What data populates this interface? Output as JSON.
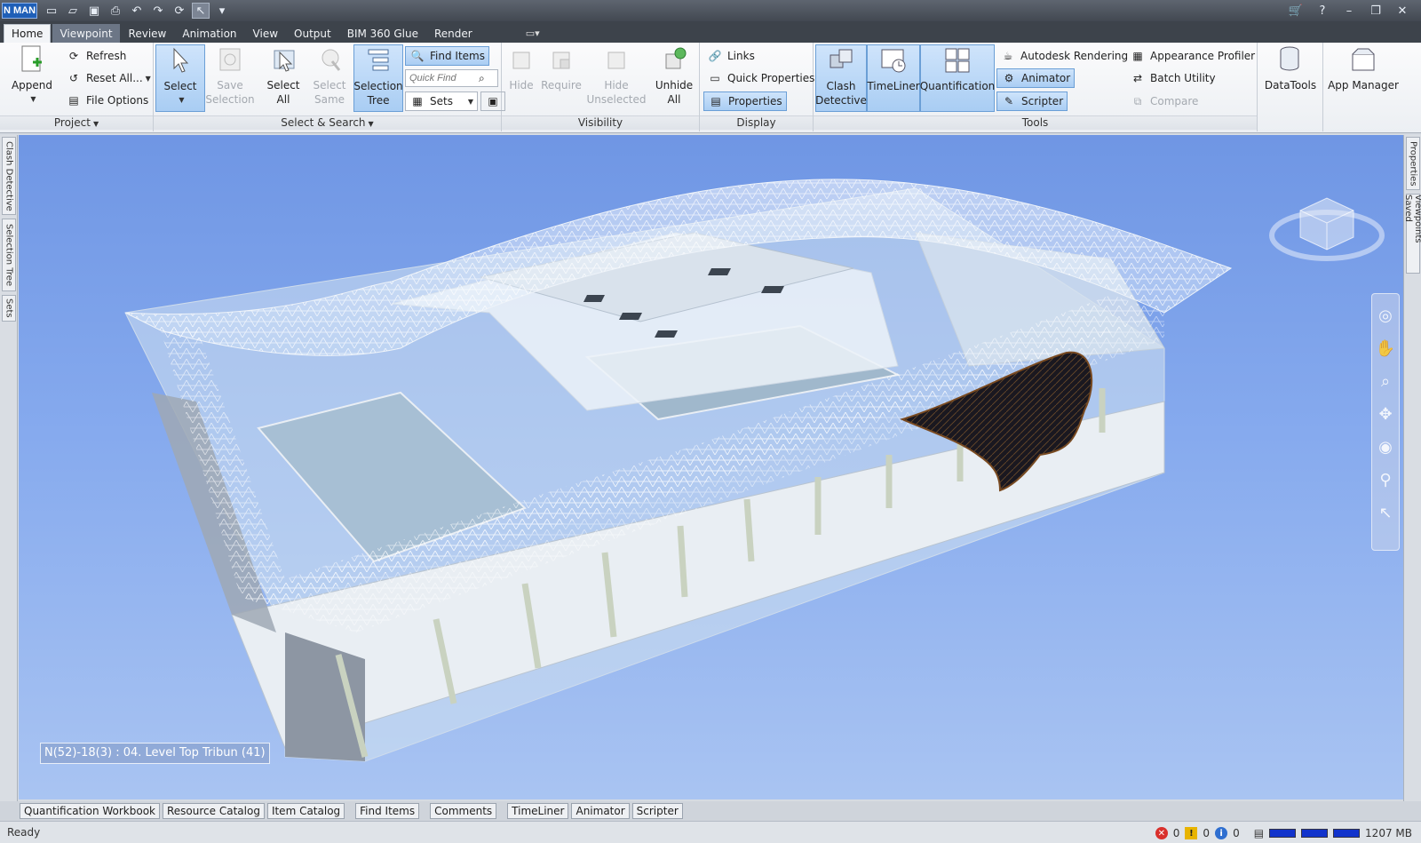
{
  "app": {
    "logo": "N MAN"
  },
  "titlebar": {
    "quick_access_icons": [
      "new-file-icon",
      "open-folder-icon",
      "save-icon",
      "print-icon",
      "undo-icon",
      "redo-icon",
      "refresh-icon",
      "select-pointer-icon",
      "customize-icon"
    ]
  },
  "tabs": [
    "Home",
    "Viewpoint",
    "Review",
    "Animation",
    "View",
    "Output",
    "BIM 360 Glue",
    "Render"
  ],
  "ribbon": {
    "project": {
      "label": "Project",
      "append": "Append",
      "refresh": "Refresh",
      "reset_all": "Reset All...",
      "file_options": "File Options"
    },
    "select_search": {
      "label": "Select & Search",
      "select": "Select",
      "save_selection_1": "Save",
      "save_selection_2": "Selection",
      "select_all_1": "Select",
      "select_all_2": "All",
      "select_same_1": "Select",
      "select_same_2": "Same",
      "selection_tree_1": "Selection",
      "selection_tree_2": "Tree",
      "find_items": "Find Items",
      "quick_find_placeholder": "Quick Find",
      "sets": "Sets"
    },
    "visibility": {
      "label": "Visibility",
      "hide": "Hide",
      "require": "Require",
      "hide_unselected_1": "Hide",
      "hide_unselected_2": "Unselected",
      "unhide_all_1": "Unhide",
      "unhide_all_2": "All"
    },
    "display": {
      "label": "Display",
      "links": "Links",
      "quick_properties": "Quick Properties",
      "properties": "Properties"
    },
    "tools": {
      "label": "Tools",
      "clash_detective_1": "Clash",
      "clash_detective_2": "Detective",
      "timeliner": "TimeLiner",
      "quantification": "Quantification",
      "autodesk_rendering": "Autodesk Rendering",
      "animator": "Animator",
      "scripter": "Scripter",
      "appearance_profiler": "Appearance Profiler",
      "batch_utility": "Batch Utility",
      "compare": "Compare"
    },
    "datatools": "DataTools",
    "app_manager": "App Manager"
  },
  "left_tabs": [
    "Clash Detective",
    "Selection Tree",
    "Sets"
  ],
  "right_tabs": [
    "Properties",
    "Saved Viewpoints"
  ],
  "viewport": {
    "selection_label": "N(52)-18(3) : 04. Level Top Tribun (41)"
  },
  "bottom_tabs": [
    "Quantification Workbook",
    "Resource Catalog",
    "Item Catalog",
    "Find Items",
    "Comments",
    "TimeLiner",
    "Animator",
    "Scripter"
  ],
  "status": {
    "text": "Ready",
    "errors": "0",
    "warnings": "0",
    "info": "0",
    "memory": "1207 MB"
  },
  "colors": {
    "accent": "#6b9fd6",
    "viewport_top": "#6f96e4",
    "viewport_bottom": "#a9c4f2",
    "titlebar": "#424851"
  }
}
